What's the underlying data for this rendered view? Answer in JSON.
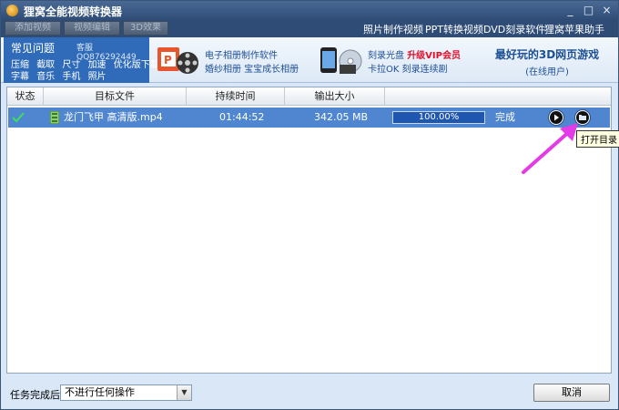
{
  "window": {
    "title": "狸窝全能视频转换器",
    "min": "_",
    "max": "□",
    "close": "×"
  },
  "toolbar": {
    "add_video": "添加视频",
    "edit_video": "视频编辑",
    "effect_3d": "3D效果",
    "links": [
      "照片制作视频",
      "PPT转换视频",
      "DVD刻录软件",
      "狸窝苹果助手"
    ]
  },
  "banner": {
    "faq_title": "常见问题",
    "faq_contact": "客服QQ876292449",
    "faq_row1": [
      "压缩",
      "截取",
      "尺寸",
      "加速",
      "优化版下载"
    ],
    "faq_row2": [
      "字幕",
      "音乐",
      "手机",
      "照片"
    ],
    "ad1_line1": "电子相册制作软件",
    "ad1_line2": "婚纱相册  宝宝成长相册",
    "ad2_line1": "刻录光盘",
    "ad2_vip": "升级VIP会员",
    "ad2_line2": "卡拉OK  刻录连续剧",
    "game_title": "最好玩的3D网页游戏",
    "game_sub": "(在线用户)"
  },
  "list": {
    "columns": [
      "状态",
      "目标文件",
      "持续时间",
      "输出大小"
    ],
    "rows": [
      {
        "file": "龙门飞甲 高清版.mp4",
        "duration": "01:44:52",
        "size": "342.05 MB",
        "progress": "100.00%",
        "progress_value": 1.0,
        "status_text": "完成"
      }
    ]
  },
  "tooltip": "打开目录",
  "bottom": {
    "after_label": "任务完成后:",
    "after_value": "不进行任何操作",
    "cancel": "取消"
  },
  "colors": {
    "selected_row": "#4f86cf",
    "progress_fill": "#1e56b0",
    "annotation_arrow": "#e33be6"
  }
}
